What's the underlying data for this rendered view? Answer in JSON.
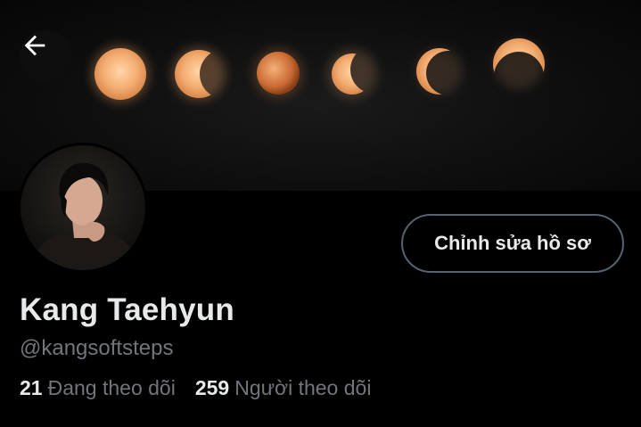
{
  "profile": {
    "name": "Kang Taehyun",
    "handle": "@kangsoftsteps",
    "edit_label": "Chỉnh sửa hồ sơ"
  },
  "stats": {
    "following_count": "21",
    "following_label": "Đang theo dõi",
    "followers_count": "259",
    "followers_label": "Người theo dõi"
  },
  "icons": {
    "back": "arrow-left-icon"
  },
  "colors": {
    "background": "#000000",
    "text_primary": "#e7e9ea",
    "text_secondary": "#71767b",
    "button_border": "#536471",
    "moon_glow": "#f3a86a"
  }
}
